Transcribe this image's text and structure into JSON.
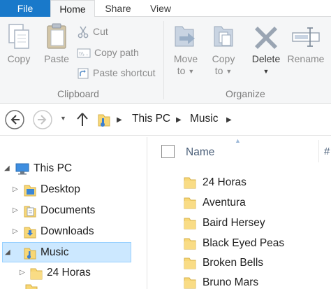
{
  "ribbon_tabs": {
    "file": "File",
    "home": "Home",
    "share": "Share",
    "view": "View"
  },
  "clipboard": {
    "copy": "Copy",
    "paste": "Paste",
    "cut": "Cut",
    "copy_path": "Copy path",
    "paste_shortcut": "Paste shortcut",
    "group_label": "Clipboard"
  },
  "organize": {
    "move_to_line1": "Move",
    "move_to_line2": "to",
    "copy_to_line1": "Copy",
    "copy_to_line2": "to",
    "delete": "Delete",
    "rename": "Rename",
    "group_label": "Organize"
  },
  "address": {
    "crumbs": [
      "This PC",
      "Music"
    ]
  },
  "nav_tree": [
    {
      "label": "This PC",
      "icon": "computer-icon"
    },
    {
      "label": "Desktop",
      "icon": "desktop-folder-icon"
    },
    {
      "label": "Documents",
      "icon": "documents-folder-icon"
    },
    {
      "label": "Downloads",
      "icon": "downloads-folder-icon"
    },
    {
      "label": "Music",
      "icon": "music-folder-icon"
    },
    {
      "label": "24 Horas",
      "icon": "folder-icon"
    }
  ],
  "file_list": {
    "column_name": "Name",
    "column_number": "#",
    "items": [
      "24 Horas",
      "Aventura",
      "Baird Hersey",
      "Black Eyed Peas",
      "Broken Bells",
      "Bruno Mars"
    ]
  },
  "colors": {
    "file_tab": "#1979ca",
    "ribbon_bg": "#f5f6f7",
    "selection_bg": "#cce8ff",
    "folder_yellow": "#f8d775"
  }
}
